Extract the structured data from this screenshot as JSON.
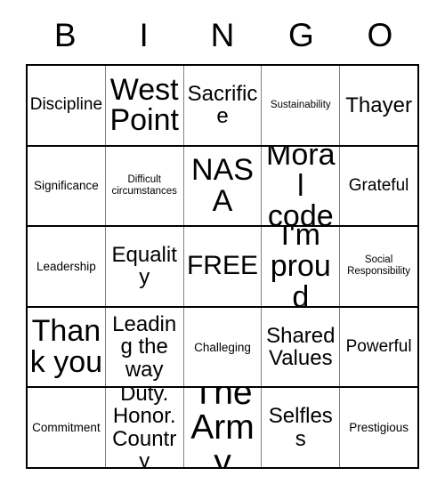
{
  "header": {
    "letters": [
      "B",
      "I",
      "N",
      "G",
      "O"
    ]
  },
  "grid": {
    "rows": [
      [
        {
          "text": "Discipline",
          "size": "fs-md"
        },
        {
          "text": "West Point",
          "size": "fs-xxl"
        },
        {
          "text": "Sacrifice",
          "size": "fs-lg"
        },
        {
          "text": "Sustainability",
          "size": "fs-xs"
        },
        {
          "text": "Thayer",
          "size": "fs-lg"
        }
      ],
      [
        {
          "text": "Significance",
          "size": "fs-sm"
        },
        {
          "text": "Difficult circumstances",
          "size": "fs-xs"
        },
        {
          "text": "NASA",
          "size": "fs-xxl"
        },
        {
          "text": "Moral code",
          "size": "fs-xxl"
        },
        {
          "text": "Grateful",
          "size": "fs-md"
        }
      ],
      [
        {
          "text": "Leadership",
          "size": "fs-sm"
        },
        {
          "text": "Equality",
          "size": "fs-lg"
        },
        {
          "text": "FREE",
          "size": "fs-xl"
        },
        {
          "text": "I'm proud",
          "size": "fs-xxl"
        },
        {
          "text": "Social Responsibility",
          "size": "fs-xs"
        }
      ],
      [
        {
          "text": "Thank you",
          "size": "fs-xxl"
        },
        {
          "text": "Leading the way",
          "size": "fs-lg"
        },
        {
          "text": "Challeging",
          "size": "fs-sm"
        },
        {
          "text": "Shared Values",
          "size": "fs-lg"
        },
        {
          "text": "Powerful",
          "size": "fs-md"
        }
      ],
      [
        {
          "text": "Commitment",
          "size": "fs-sm"
        },
        {
          "text": "Duty. Honor. Country",
          "size": "fs-lg"
        },
        {
          "text": "The Army",
          "size": "fs-huge"
        },
        {
          "text": "Selfless",
          "size": "fs-lg"
        },
        {
          "text": "Prestigious",
          "size": "fs-sm"
        }
      ]
    ]
  }
}
